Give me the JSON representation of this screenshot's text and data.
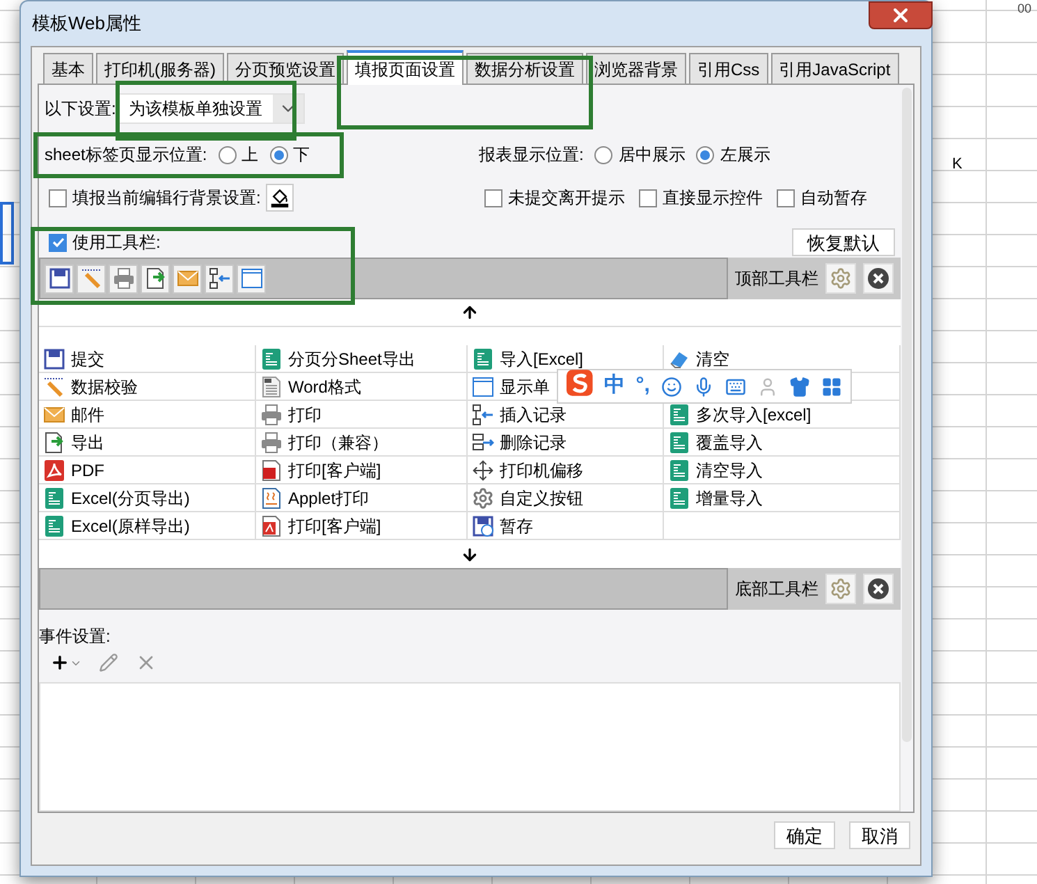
{
  "background": {
    "ruler_text": "00",
    "column_header": "K"
  },
  "window": {
    "title": "模板Web属性"
  },
  "tabs": [
    {
      "label": "基本",
      "selected": false
    },
    {
      "label": "打印机(服务器)",
      "selected": false
    },
    {
      "label": "分页预览设置",
      "selected": false
    },
    {
      "label": "填报页面设置",
      "selected": true
    },
    {
      "label": "数据分析设置",
      "selected": false
    },
    {
      "label": "浏览器背景",
      "selected": false
    },
    {
      "label": "引用Css",
      "selected": false
    },
    {
      "label": "引用JavaScript",
      "selected": false
    }
  ],
  "scope": {
    "label": "以下设置:",
    "value": "为该模板单独设置"
  },
  "sheet_tab_position": {
    "label": "sheet标签页显示位置:",
    "options": [
      {
        "label": "上",
        "selected": false
      },
      {
        "label": "下",
        "selected": true
      }
    ]
  },
  "report_position": {
    "label": "报表显示位置:",
    "options": [
      {
        "label": "居中展示",
        "selected": false
      },
      {
        "label": "左展示",
        "selected": true
      }
    ]
  },
  "row_background": {
    "label": "填报当前编辑行背景设置:",
    "checked": false
  },
  "options": [
    {
      "label": "未提交离开提示",
      "checked": false
    },
    {
      "label": "直接显示控件",
      "checked": false
    },
    {
      "label": "自动暂存",
      "checked": false
    }
  ],
  "use_toolbar": {
    "label": "使用工具栏:",
    "checked": true
  },
  "restore_button": "恢复默认",
  "top_toolbar": {
    "label": "顶部工具栏",
    "buttons": [
      {
        "kind": "save"
      },
      {
        "kind": "edit"
      },
      {
        "kind": "print"
      },
      {
        "kind": "export"
      },
      {
        "kind": "mail"
      },
      {
        "kind": "insert"
      },
      {
        "kind": "window"
      }
    ]
  },
  "toolbar_options": [
    [
      {
        "label": "提交",
        "kind": "save"
      },
      {
        "label": "分页分Sheet导出",
        "kind": "excel"
      },
      {
        "label": "导入[Excel]",
        "kind": "excel"
      },
      {
        "label": "清空",
        "kind": "eraser"
      }
    ],
    [
      {
        "label": "数据校验",
        "kind": "edit"
      },
      {
        "label": "Word格式",
        "kind": "word"
      },
      {
        "label": "显示单",
        "kind": "window"
      }
    ],
    [
      {
        "label": "邮件",
        "kind": "mail"
      },
      {
        "label": "打印",
        "kind": "print"
      },
      {
        "label": "插入记录",
        "kind": "insert"
      },
      {
        "label": "多次导入[excel]",
        "kind": "excel"
      }
    ],
    [
      {
        "label": "导出",
        "kind": "export"
      },
      {
        "label": "打印（兼容）",
        "kind": "print"
      },
      {
        "label": "删除记录",
        "kind": "delete"
      },
      {
        "label": "覆盖导入",
        "kind": "excel"
      }
    ],
    [
      {
        "label": "PDF",
        "kind": "pdf"
      },
      {
        "label": "打印[客户端]",
        "kind": "flash"
      },
      {
        "label": "打印机偏移",
        "kind": "move"
      },
      {
        "label": "清空导入",
        "kind": "excel"
      }
    ],
    [
      {
        "label": "Excel(分页导出)",
        "kind": "excel"
      },
      {
        "label": "Applet打印",
        "kind": "applet"
      },
      {
        "label": "自定义按钮",
        "kind": "gear"
      },
      {
        "label": "增量导入",
        "kind": "excel"
      }
    ],
    [
      {
        "label": "Excel(原样导出)",
        "kind": "excel"
      },
      {
        "label": "打印[客户端]",
        "kind": "pdfdoc"
      },
      {
        "label": "暂存",
        "kind": "saveclock"
      }
    ]
  ],
  "bottom_toolbar": {
    "label": "底部工具栏"
  },
  "events": {
    "label": "事件设置:"
  },
  "footer_buttons": [
    "确定",
    "取消"
  ],
  "input_method_bar": {
    "texts": [
      "中",
      "°,"
    ]
  }
}
